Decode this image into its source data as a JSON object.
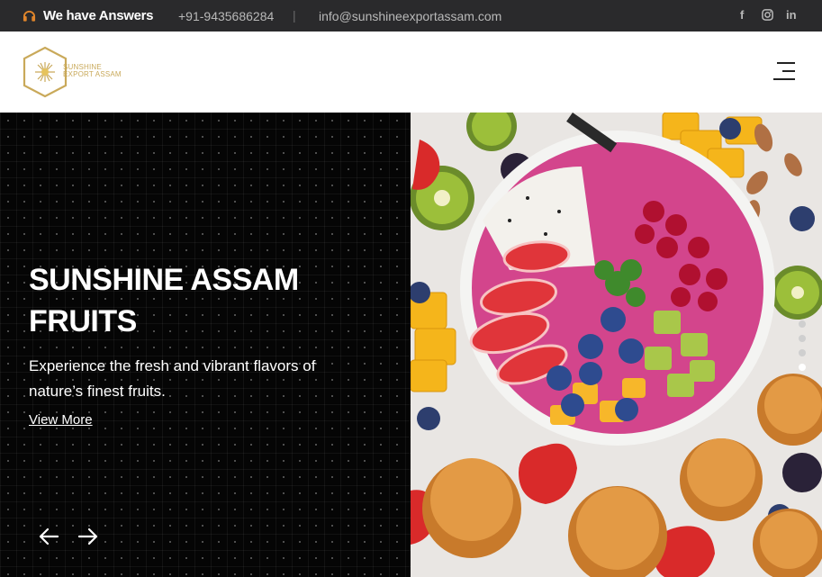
{
  "topbar": {
    "tagline": "We have Answers",
    "phone": "+91-9435686284",
    "separator": "|",
    "email": "info@sunshineexportassam.com",
    "social": {
      "facebook": "f",
      "instagram": "instagram-icon",
      "linkedin": "in"
    }
  },
  "header": {
    "logo_line1": "SUNSHINE",
    "logo_line2": "EXPORT ASSAM",
    "menu_icon": "hamburger-menu-icon"
  },
  "hero": {
    "title": "SUNSHINE ASSAM FRUITS",
    "subtitle": "Experience the fresh and vibrant flavors of nature’s finest fruits.",
    "cta_label": "View More",
    "prev_icon": "arrow-left-icon",
    "next_icon": "arrow-right-icon",
    "image_alt": "Smoothie bowl with strawberries, blueberries, kiwi, mango, pomegranate and muffins",
    "slides_total": 4,
    "slide_active": 4
  },
  "colors": {
    "topbar_bg": "#2a2a2c",
    "accent_gold": "#c9a95a",
    "hero_bg": "#050505",
    "headset_orange": "#e0852b"
  }
}
